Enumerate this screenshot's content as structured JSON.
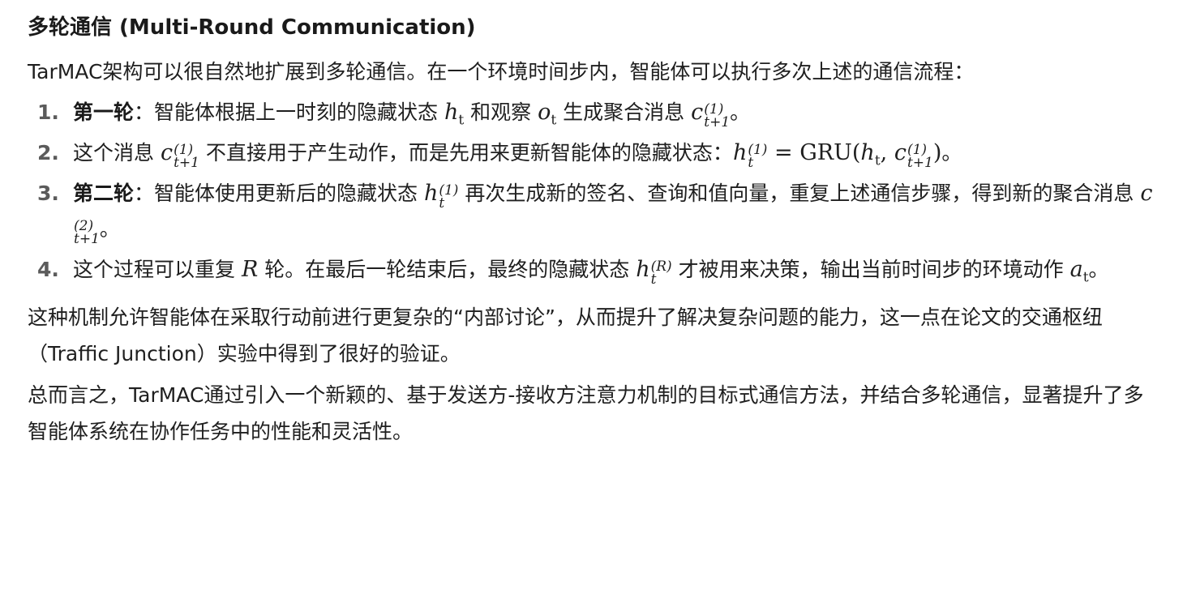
{
  "heading": "多轮通信 (Multi-Round Communication)",
  "intro": "TarMAC架构可以很自然地扩展到多轮通信。在一个环境时间步内，智能体可以执行多次上述的通信流程：",
  "steps": [
    {
      "number": "1.",
      "bold": "第一轮",
      "text_a": "：智能体根据上一时刻的隐藏状态 ",
      "text_b": " 和观察 ",
      "text_c": " 生成聚合消息 ",
      "text_d": "。"
    },
    {
      "number": "2.",
      "text_a": "这个消息 ",
      "text_b": " 不直接用于产生动作，而是先用来更新智能体的隐藏状态：",
      "gru": "GRU",
      "text_c": "。"
    },
    {
      "number": "3.",
      "bold": "第二轮",
      "text_a": "：智能体使用更新后的隐藏状态 ",
      "text_b": " 再次生成新的签名、查询和值向量，重复上述通信步骤，得到新的聚合消息 ",
      "text_c": "。"
    },
    {
      "number": "4.",
      "text_a": "这个过程可以重复 ",
      "text_b": " 轮。在最后一轮结束后，最终的隐藏状态 ",
      "text_c": " 才被用来决策，输出当前时间步的环境动作 ",
      "text_d": "。"
    }
  ],
  "math": {
    "h": "h",
    "o": "o",
    "c": "c",
    "a": "a",
    "R": "R",
    "t": "t",
    "t1": "t+1",
    "r1": "(1)",
    "r2": "(2)",
    "rR": "(R)",
    "eq": " = ",
    "lp": "(",
    "rp": ")",
    "comma": ", "
  },
  "discussion": "这种机制允许智能体在采取行动前进行更复杂的“内部讨论”，从而提升了解决复杂问题的能力，这一点在论文的交通枢纽（Traffic Junction）实验中得到了很好的验证。",
  "conclusion": "总而言之，TarMAC通过引入一个新颖的、基于发送方-接收方注意力机制的目标式通信方法，并结合多轮通信，显著提升了多智能体系统在协作任务中的性能和灵活性。"
}
